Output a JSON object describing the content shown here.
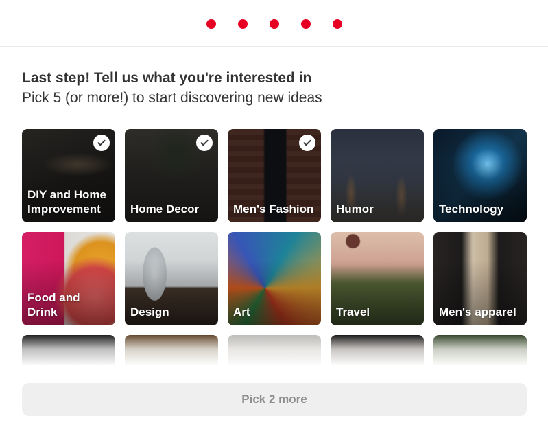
{
  "progress": {
    "total_steps": 5,
    "current_step": 5,
    "color": "#e60023"
  },
  "header": {
    "title": "Last step! Tell us what you're interested in",
    "subtitle": "Pick 5 (or more!) to start discovering new ideas"
  },
  "topics": [
    {
      "label": "DIY and Home Improvement",
      "selected": true,
      "art": "diy"
    },
    {
      "label": "Home Decor",
      "selected": true,
      "art": "decor"
    },
    {
      "label": "Men's Fashion",
      "selected": true,
      "art": "fashion"
    },
    {
      "label": "Humor",
      "selected": false,
      "art": "humor"
    },
    {
      "label": "Technology",
      "selected": false,
      "art": "tech"
    },
    {
      "label": "Food and Drink",
      "selected": false,
      "art": "food"
    },
    {
      "label": "Design",
      "selected": false,
      "art": "design"
    },
    {
      "label": "Art",
      "selected": false,
      "art": "art"
    },
    {
      "label": "Travel",
      "selected": false,
      "art": "travel"
    },
    {
      "label": "Men's apparel",
      "selected": false,
      "art": "apparel"
    },
    {
      "label": "",
      "selected": false,
      "art": "r3a"
    },
    {
      "label": "",
      "selected": false,
      "art": "r3b"
    },
    {
      "label": "",
      "selected": false,
      "art": "r3c"
    },
    {
      "label": "",
      "selected": false,
      "art": "r3d"
    },
    {
      "label": "",
      "selected": false,
      "art": "r3e"
    }
  ],
  "footer": {
    "button_label": "Pick 2 more"
  }
}
